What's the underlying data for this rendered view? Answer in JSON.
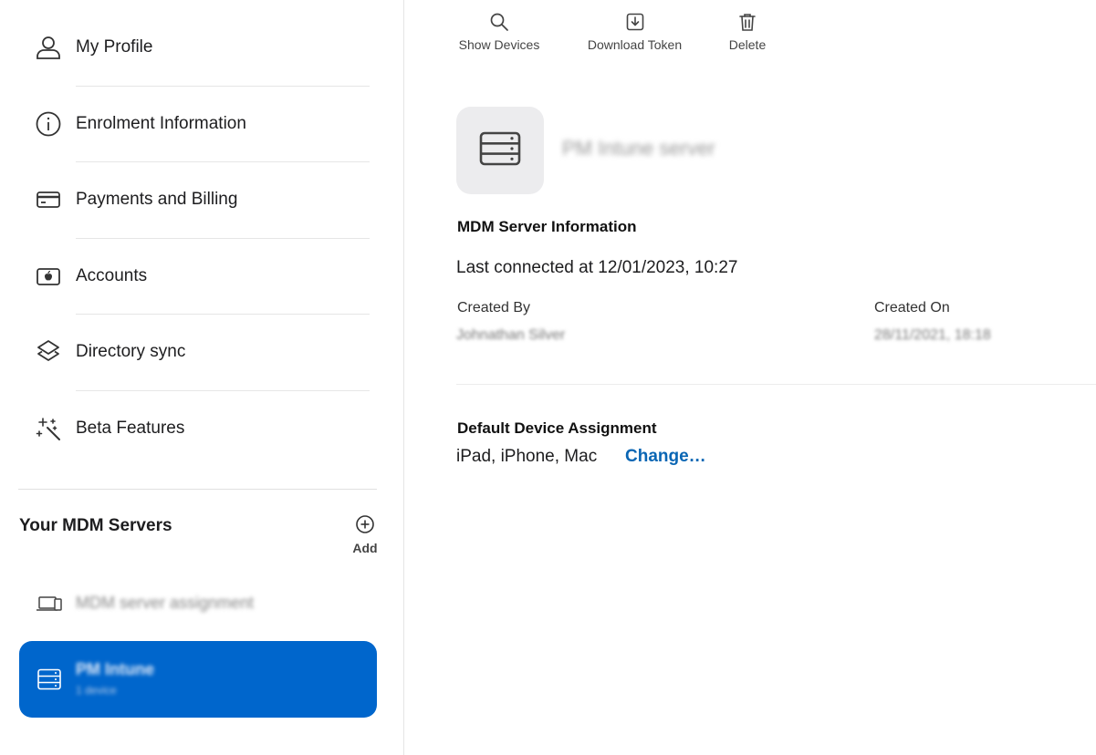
{
  "sidebar": {
    "items": [
      {
        "label": "My Profile",
        "icon": "person-icon"
      },
      {
        "label": "Enrolment Information",
        "icon": "info-icon"
      },
      {
        "label": "Payments and Billing",
        "icon": "credit-card-icon"
      },
      {
        "label": "Accounts",
        "icon": "apple-account-icon"
      },
      {
        "label": "Directory sync",
        "icon": "layers-icon"
      },
      {
        "label": "Beta Features",
        "icon": "sparkles-wand-icon"
      }
    ],
    "servers_title": "Your MDM Servers",
    "add_label": "Add",
    "servers": [
      {
        "name": "MDM server assignment",
        "icon": "devices-icon"
      },
      {
        "name": "PM Intune",
        "subtitle": "1 device",
        "icon": "server-icon"
      }
    ],
    "accent_color": "#0066cc"
  },
  "toolbar": {
    "show_devices": "Show Devices",
    "download_token": "Download Token",
    "delete": "Delete"
  },
  "detail": {
    "server_name": "PM Intune server",
    "info_title": "MDM Server Information",
    "last_connected": "Last connected at 12/01/2023, 10:27",
    "created_by_label": "Created By",
    "created_by_value": "Johnathan Silver",
    "created_on_label": "Created On",
    "created_on_value": "28/11/2021, 18:18",
    "assignment_title": "Default Device Assignment",
    "assignment_value": "iPad, iPhone, Mac",
    "change_label": "Change…",
    "link_color": "#0a66b4"
  }
}
